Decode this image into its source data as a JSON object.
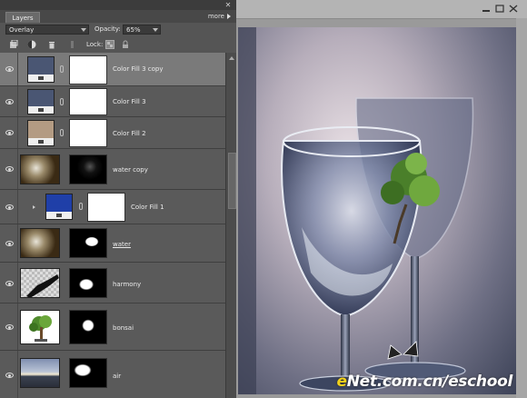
{
  "panel": {
    "tab_label": "Layers",
    "more_label": "more",
    "blend_mode": "Overlay",
    "opacity_label": "Opacity:",
    "opacity_value": "65%",
    "lock_label": "Lock:"
  },
  "layers": [
    {
      "name": "Color Fill 3 copy",
      "selected": true,
      "thumb_color": "#4a5673",
      "type": "fill"
    },
    {
      "name": "Color Fill 3",
      "selected": false,
      "thumb_color": "#4a5673",
      "type": "fill"
    },
    {
      "name": "Color Fill 2",
      "selected": false,
      "thumb_color": "#b39b83",
      "type": "fill"
    },
    {
      "name": "water copy",
      "selected": false,
      "type": "image"
    },
    {
      "name": "Color Fill 1",
      "selected": false,
      "thumb_color": "#1f3fa8",
      "type": "fill"
    },
    {
      "name": "water",
      "selected": false,
      "type": "image",
      "underlined": true
    },
    {
      "name": "harmony",
      "selected": false,
      "type": "image"
    },
    {
      "name": "bonsai",
      "selected": false,
      "type": "image"
    },
    {
      "name": "air",
      "selected": false,
      "type": "image"
    }
  ],
  "watermark": {
    "e": "e",
    "rest": "Net.com.cn/eschool"
  },
  "colors": {
    "panel_bg": "#5a5a5a",
    "selected_row": "#7a7a7a",
    "watermark_yellow": "#f2d11a"
  }
}
